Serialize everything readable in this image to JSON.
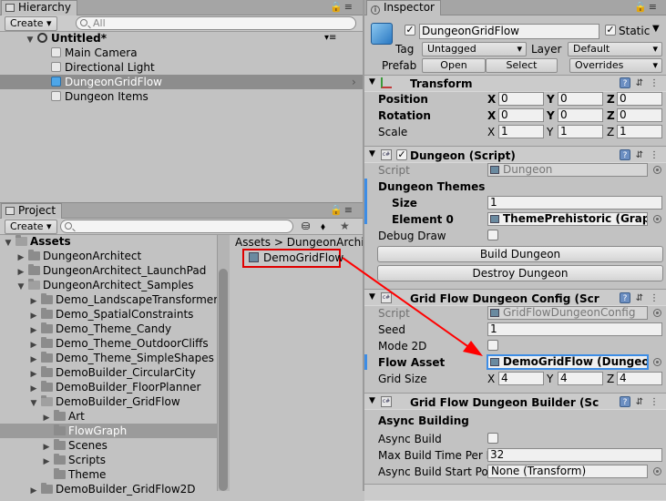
{
  "hierarchy": {
    "tab": "Hierarchy",
    "create_label": "Create",
    "search_placeholder": "All",
    "scene_name": "Untitled*",
    "items": [
      {
        "label": "Main Camera"
      },
      {
        "label": "Directional Light"
      },
      {
        "label": "DungeonGridFlow",
        "selected": true
      },
      {
        "label": "Dungeon Items"
      }
    ]
  },
  "project": {
    "tab": "Project",
    "create_label": "Create",
    "search_placeholder": "",
    "badge": "13",
    "breadcrumb": "Assets > DungeonArchit",
    "asset_item": "DemoGridFlow",
    "tree": [
      {
        "label": "Assets"
      },
      {
        "label": "DungeonArchitect"
      },
      {
        "label": "DungeonArchitect_LaunchPad"
      },
      {
        "label": "DungeonArchitect_Samples"
      },
      {
        "label": "Demo_LandscapeTransformer"
      },
      {
        "label": "Demo_SpatialConstraints"
      },
      {
        "label": "Demo_Theme_Candy"
      },
      {
        "label": "Demo_Theme_OutdoorCliffs"
      },
      {
        "label": "Demo_Theme_SimpleShapes"
      },
      {
        "label": "DemoBuilder_CircularCity"
      },
      {
        "label": "DemoBuilder_FloorPlanner"
      },
      {
        "label": "DemoBuilder_GridFlow"
      },
      {
        "label": "Art"
      },
      {
        "label": "FlowGraph"
      },
      {
        "label": "Scenes"
      },
      {
        "label": "Scripts"
      },
      {
        "label": "Theme"
      },
      {
        "label": "DemoBuilder_GridFlow2D"
      }
    ]
  },
  "inspector": {
    "tab": "Inspector",
    "object_name": "DungeonGridFlow",
    "static_label": "Static",
    "tag_label": "Tag",
    "tag_value": "Untagged",
    "layer_label": "Layer",
    "layer_value": "Default",
    "prefab_label": "Prefab",
    "prefab_open": "Open",
    "prefab_select": "Select",
    "prefab_overrides": "Overrides",
    "transform": {
      "title": "Transform",
      "position_label": "Position",
      "rotation_label": "Rotation",
      "scale_label": "Scale",
      "x": "X",
      "y": "Y",
      "z": "Z",
      "position": [
        "0",
        "0",
        "0"
      ],
      "rotation": [
        "0",
        "0",
        "0"
      ],
      "scale": [
        "1",
        "1",
        "1"
      ]
    },
    "dungeon": {
      "title": "Dungeon (Script)",
      "script_label": "Script",
      "script_value": "Dungeon",
      "themes_label": "Dungeon Themes",
      "size_label": "Size",
      "size_value": "1",
      "element_label": "Element 0",
      "element_value": "ThemePrehistoric (Grapl",
      "debug_label": "Debug Draw",
      "build_button": "Build Dungeon",
      "destroy_button": "Destroy Dungeon"
    },
    "config": {
      "title": "Grid Flow Dungeon Config (Scrip",
      "script_label": "Script",
      "script_value": "GridFlowDungeonConfig",
      "seed_label": "Seed",
      "seed_value": "1",
      "mode2d_label": "Mode 2D",
      "flow_label": "Flow Asset",
      "flow_value": "DemoGridFlow (Dungeor",
      "gridsize_label": "Grid Size",
      "gridsize": [
        "4",
        "4",
        "4"
      ]
    },
    "builder": {
      "title": "Grid Flow Dungeon Builder (Scri",
      "async_heading": "Async Building",
      "async_build_label": "Async Build",
      "max_time_label": "Max Build Time Per F",
      "max_time_value": "32",
      "start_pos_label": "Async Build Start Pos",
      "start_pos_value": "None (Transform)"
    }
  },
  "colors": {
    "selection": "#8d8d8d",
    "accent": "#3d8de6",
    "arrow": "#ff0000"
  }
}
